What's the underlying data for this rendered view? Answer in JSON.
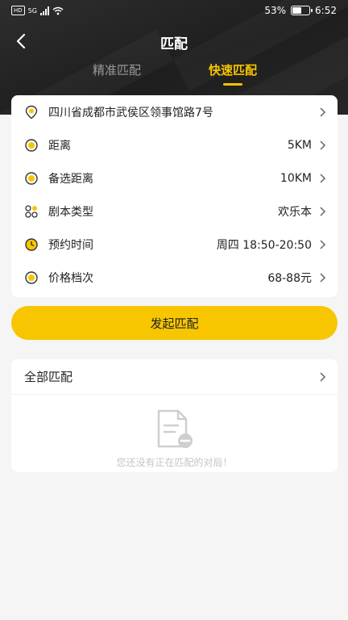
{
  "status_bar": {
    "network": "HD",
    "signal_type": "5G",
    "battery": "53%",
    "time": "6:52"
  },
  "nav": {
    "title": "匹配",
    "tabs": [
      {
        "label": "精准匹配",
        "active": false
      },
      {
        "label": "快速匹配",
        "active": true
      }
    ]
  },
  "form": {
    "location": {
      "label": "四川省成都市武侯区领事馆路7号",
      "value": ""
    },
    "distance": {
      "label": "距离",
      "value": "5KM"
    },
    "alt_distance": {
      "label": "备选距离",
      "value": "10KM"
    },
    "script_type": {
      "label": "剧本类型",
      "value": "欢乐本"
    },
    "reserve_time": {
      "label": "预约时间",
      "value": "周四 18:50-20:50"
    },
    "price_level": {
      "label": "价格档次",
      "value": "68-88元"
    }
  },
  "actions": {
    "start_match": "发起匹配"
  },
  "matches": {
    "title": "全部匹配",
    "empty_text": "您还没有正在匹配的对局！"
  },
  "colors": {
    "accent": "#f8c600",
    "header_bg": "#262626",
    "page_bg": "#f5f5f5"
  }
}
